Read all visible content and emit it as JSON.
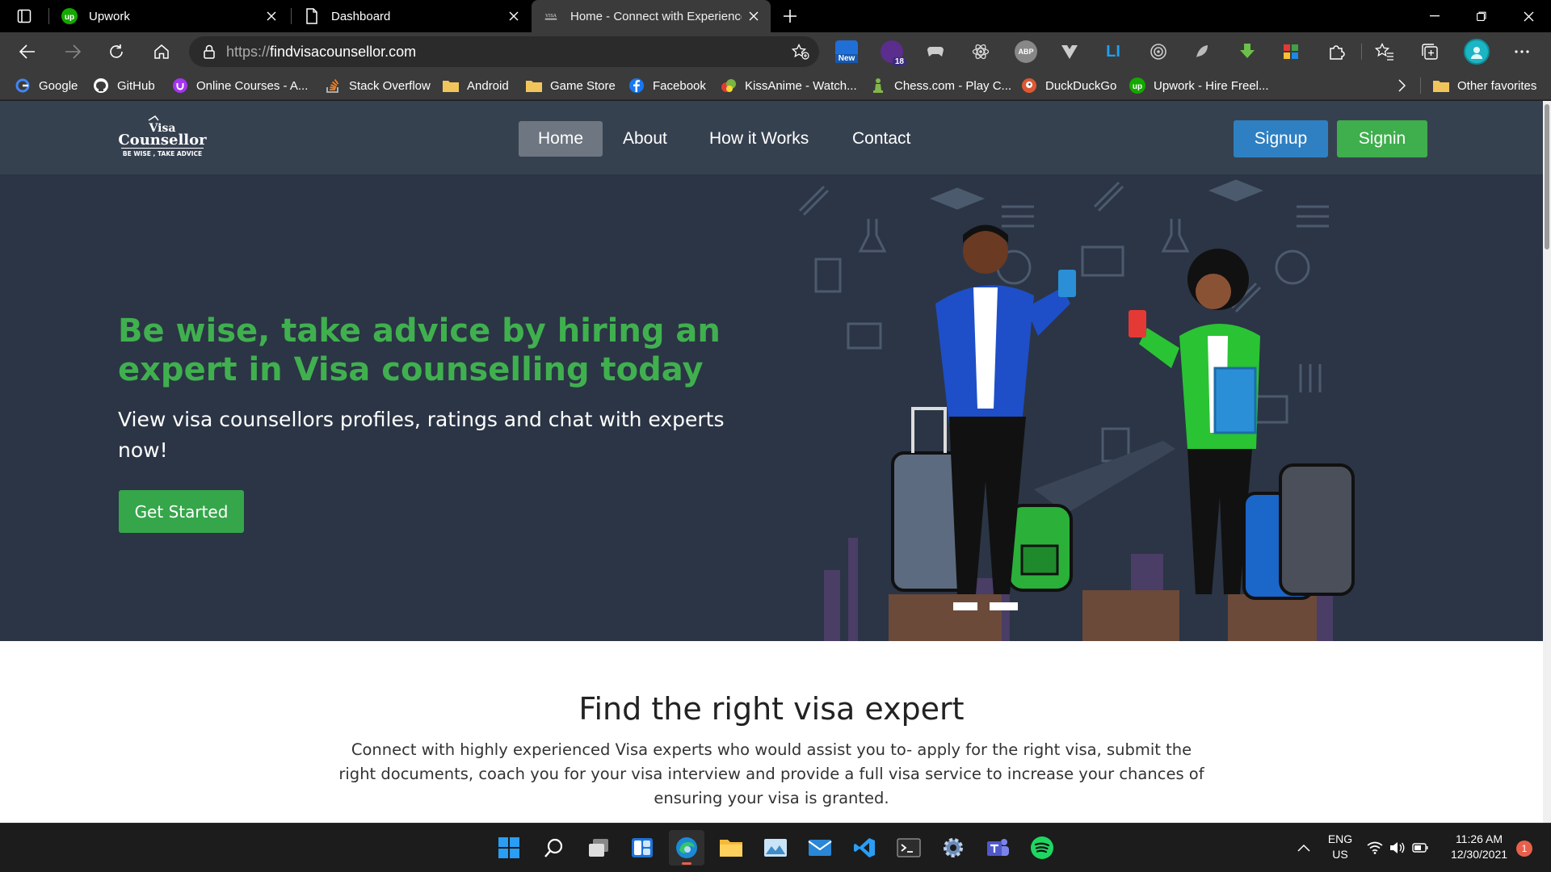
{
  "browser": {
    "tabs": [
      {
        "title": "Upwork",
        "active": false
      },
      {
        "title": "Dashboard",
        "active": false
      },
      {
        "title": "Home - Connect with Experienced",
        "active": true
      }
    ],
    "url": {
      "protocol": "https://",
      "host": "findvisacounsellor.com"
    },
    "extensions": [
      {
        "name": "new-badge-extension",
        "badge": "New"
      },
      {
        "name": "notification-extension",
        "badge": "18"
      },
      {
        "name": "gamepad-extension"
      },
      {
        "name": "react-devtools-extension"
      },
      {
        "name": "adblock-plus-extension",
        "badge": "ABP"
      },
      {
        "name": "vue-devtools-extension"
      },
      {
        "name": "linkedin-extension",
        "badge": "LI"
      },
      {
        "name": "target-extension"
      },
      {
        "name": "feather-extension"
      },
      {
        "name": "download-extension"
      },
      {
        "name": "color-picker-extension"
      }
    ],
    "bookmarks": [
      {
        "label": "Google",
        "icon": "google-icon"
      },
      {
        "label": "GitHub",
        "icon": "github-icon"
      },
      {
        "label": "Online Courses - A...",
        "icon": "udemy-icon"
      },
      {
        "label": "Stack Overflow",
        "icon": "stackoverflow-icon"
      },
      {
        "label": "Android",
        "icon": "folder-icon"
      },
      {
        "label": "Game Store",
        "icon": "folder-icon"
      },
      {
        "label": "Facebook",
        "icon": "facebook-icon"
      },
      {
        "label": "KissAnime - Watch...",
        "icon": "kissanime-icon"
      },
      {
        "label": "Chess.com - Play C...",
        "icon": "chess-icon"
      },
      {
        "label": "DuckDuckGo",
        "icon": "duckduckgo-icon"
      },
      {
        "label": "Upwork - Hire Freel...",
        "icon": "upwork-icon"
      }
    ],
    "other_favorites": "Other favorites"
  },
  "site": {
    "logo": {
      "line1": "Visa",
      "line2": "Counsellor",
      "tagline": "BE WISE , TAKE ADVICE"
    },
    "nav": [
      {
        "label": "Home",
        "active": true
      },
      {
        "label": "About",
        "active": false
      },
      {
        "label": "How it Works",
        "active": false
      },
      {
        "label": "Contact",
        "active": false
      }
    ],
    "signup": "Signup",
    "signin": "Signin",
    "hero": {
      "title": "Be wise, take advice by hiring an expert in Visa counselling today",
      "subtitle": "View visa counsellors profiles, ratings and chat with experts now!",
      "cta": "Get Started"
    },
    "expert": {
      "title": "Find the right visa expert",
      "text": "Connect with highly experienced Visa experts who would assist you to- apply for the right visa, submit the right documents, coach you for your visa interview and provide a full visa service to increase your chances of ensuring your visa is granted."
    },
    "colors": {
      "accent_green": "#40b04f",
      "nav_bg": "#364150",
      "hero_bg": "#2b3545",
      "signup_blue": "#2e80c3",
      "signin_green": "#3fae4c"
    }
  },
  "taskbar": {
    "language": "ENG",
    "region": "US",
    "time": "11:26 AM",
    "date": "12/30/2021",
    "notification_count": "1"
  }
}
